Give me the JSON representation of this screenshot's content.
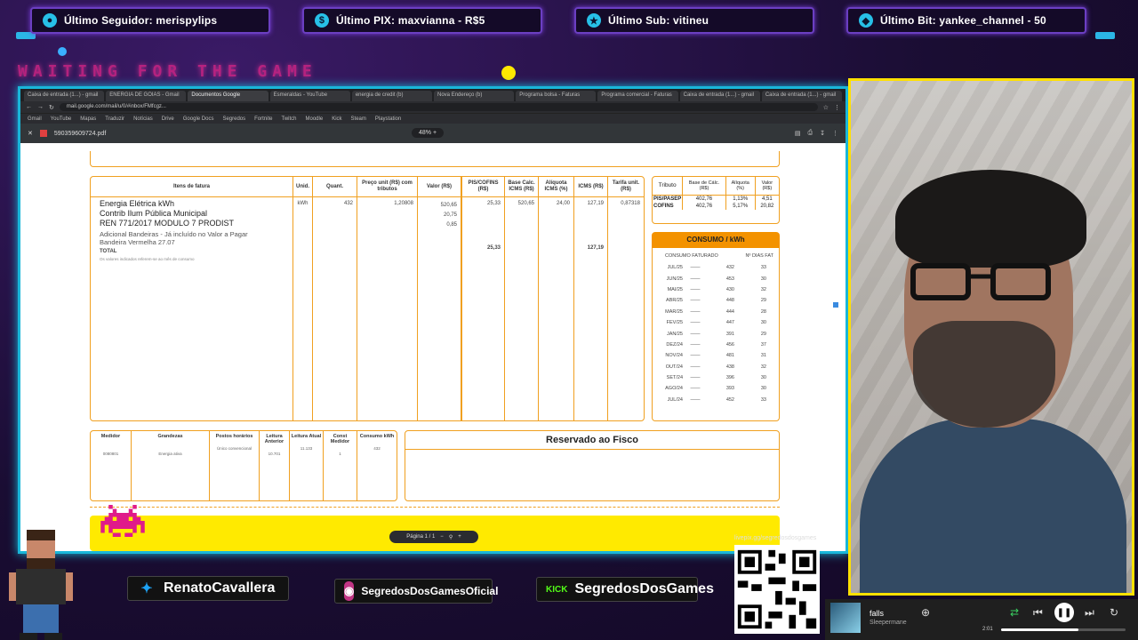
{
  "overlay": {
    "alerts": [
      {
        "icon": "user-icon",
        "text": "Último Seguidor: merispylips"
      },
      {
        "icon": "dollar-icon",
        "text": "Último PIX: maxvianna - R$5"
      },
      {
        "icon": "star-icon",
        "text": "Último Sub: vitineu"
      },
      {
        "icon": "diamond-icon",
        "text": "Último Bit: yankee_channel - 50"
      }
    ],
    "waiting_text": "WAITING FOR THE GAME",
    "socials": [
      {
        "platform": "twitter",
        "handle": "RenatoCavallera",
        "color": "#1da1f2"
      },
      {
        "platform": "instagram",
        "handle": "SegredosDosGamesOficial",
        "color": "#c13584"
      },
      {
        "platform": "kick",
        "handle": "SegredosDosGames",
        "color": "#53fc18",
        "badge": "KICK"
      }
    ],
    "qr_label": "livepix.gg/segredosdosgames",
    "colors": {
      "accent": "#19b6d9",
      "cam_border": "#ffe000",
      "pink": "#e0268a"
    }
  },
  "browser": {
    "tabs": [
      "Caixa de entrada (1...) - gmail",
      "ENERGIA DE GOIAS - Gmail",
      "Documentos Google",
      "Esmeraldas - YouTube",
      "energia de credit (b)",
      "Nova Endereço (b)",
      "Programa bolsa - Faturas",
      "Programa comercial - Faturas",
      "Caixa de entrada (1...) - gmail",
      "Caixa de entrada (1...) - gmail"
    ],
    "url": "mail.google.com/mail/u/0/#inbox/FMfcgz...",
    "bookmarks": [
      "Gmail",
      "YouTube",
      "Mapas",
      "Traduzir",
      "Notícias",
      "Drive",
      "Google Docs",
      "Segredos",
      "Fortnite",
      "Twitch",
      "Moodle",
      "Kick",
      "Steam",
      "Playstation"
    ],
    "pdf_filename": "590359609724.pdf",
    "zoom": "48% +",
    "pager": "Página 1 / 1"
  },
  "invoice": {
    "items_header": [
      "Itens de fatura",
      "Unid.",
      "Quant.",
      "Preço unit (R$) com tributos",
      "Valor (R$)",
      "PIS/COFINS (R$)",
      "Base Calc. ICMS (R$)",
      "Alíquota ICMS (%)",
      "ICMS (R$)",
      "Tarifa unit. (R$)"
    ],
    "items": {
      "line1": "Energia Elétrica kWh",
      "line2": "Contrib Ilum Pública Municipal",
      "line3": "REN 771/2017 MODULO 7 PRODIST",
      "line4": "Adicional Bandeiras - Já incluído no Valor a Pagar",
      "line5": "Bandeira Vermelha 27.07",
      "total": "TOTAL",
      "unid": "kWh",
      "quant": "432",
      "preco": "1,20808",
      "valor1": "520,65",
      "valor2": "20,75",
      "valor3": "0,85",
      "pis": "25,33",
      "base": "520,65",
      "aliquota": "24,00",
      "icms": "127,19",
      "tarifa": "0,87318",
      "total_pis": "25,33",
      "total_icms": "127,19",
      "note": "Os valores indicados referem-se ao mês de consumo"
    },
    "tributo": {
      "header": [
        "Tributo",
        "Base de Cálc. (R$)",
        "Alíquota (%)",
        "Valor (R$)"
      ],
      "rows": [
        [
          "PIS/PASEP",
          "402,76",
          "1,13%",
          "4,51"
        ],
        [
          "COFINS",
          "402,76",
          "5,17%",
          "20,82"
        ]
      ]
    },
    "consumo": {
      "title": "CONSUMO / kWh",
      "col1": "CONSUMO FATURADO",
      "col2": "Nº DIAS FAT",
      "rows": [
        [
          "JUL/25",
          "432",
          "33"
        ],
        [
          "JUN/25",
          "453",
          "30"
        ],
        [
          "MAI/25",
          "430",
          "32"
        ],
        [
          "ABR/25",
          "448",
          "29"
        ],
        [
          "MAR/25",
          "444",
          "28"
        ],
        [
          "FEV/25",
          "447",
          "30"
        ],
        [
          "JAN/25",
          "391",
          "29"
        ],
        [
          "DEZ/24",
          "456",
          "37"
        ],
        [
          "NOV/24",
          "481",
          "31"
        ],
        [
          "OUT/24",
          "438",
          "32"
        ],
        [
          "SET/24",
          "396",
          "30"
        ],
        [
          "AGO/24",
          "393",
          "30"
        ],
        [
          "JUL/24",
          "452",
          "33"
        ]
      ]
    },
    "medidor": {
      "header": [
        "Medidor",
        "Grandezas",
        "Postos horários",
        "Leitura Anterior",
        "Leitura Atual",
        "Const Medidor",
        "Consumo kWh"
      ],
      "row": [
        "0080801",
        "Energia ativa",
        "Único convencional",
        "10.701",
        "11.133",
        "1",
        "432"
      ]
    },
    "fisco_title": "Reservado ao Fisco"
  },
  "music": {
    "title": "falls",
    "artist": "Sleepermane",
    "time": "2:01",
    "progress": 0.62
  }
}
